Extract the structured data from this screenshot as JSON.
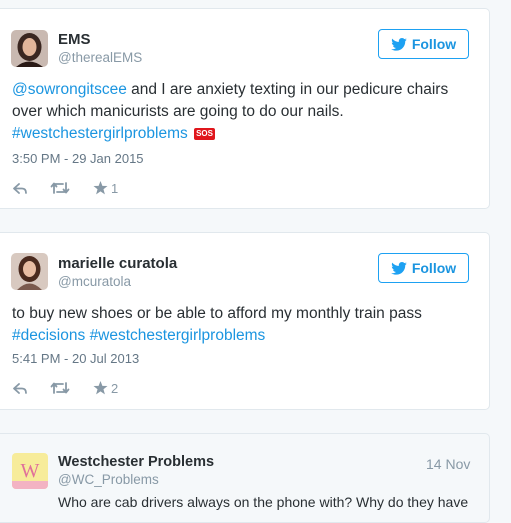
{
  "tweets": [
    {
      "name": "EMS",
      "handle": "@therealEMS",
      "follow_label": "Follow",
      "mention": "@sowrongitscee",
      "text_rest": " and I are anxiety texting in our pedicure chairs over which manicurists are going to do our nails.",
      "hashtag": "#westchestergirlproblems",
      "emoji_label": "SOS",
      "timestamp": "3:50 PM - 29 Jan 2015",
      "like_count": "1"
    },
    {
      "name": "marielle curatola",
      "handle": "@mcuratola",
      "follow_label": "Follow",
      "text": "to buy new shoes or be able to afford my monthly train pass",
      "hashtag1": "#decisions",
      "hashtag2": "#westchestergirlproblems",
      "timestamp": "5:41 PM - 20 Jul 2013",
      "like_count": "2"
    }
  ],
  "quoted": {
    "name": "Westchester Problems",
    "handle": "@WC_Problems",
    "date": "14 Nov",
    "avatar_letter": "W",
    "text": "Who are cab drivers always on the phone with? Why do they have"
  },
  "colors": {
    "link": "#1b95e0",
    "follow_border": "#1da1f2",
    "muted": "#8899a6",
    "text": "#292f33"
  }
}
